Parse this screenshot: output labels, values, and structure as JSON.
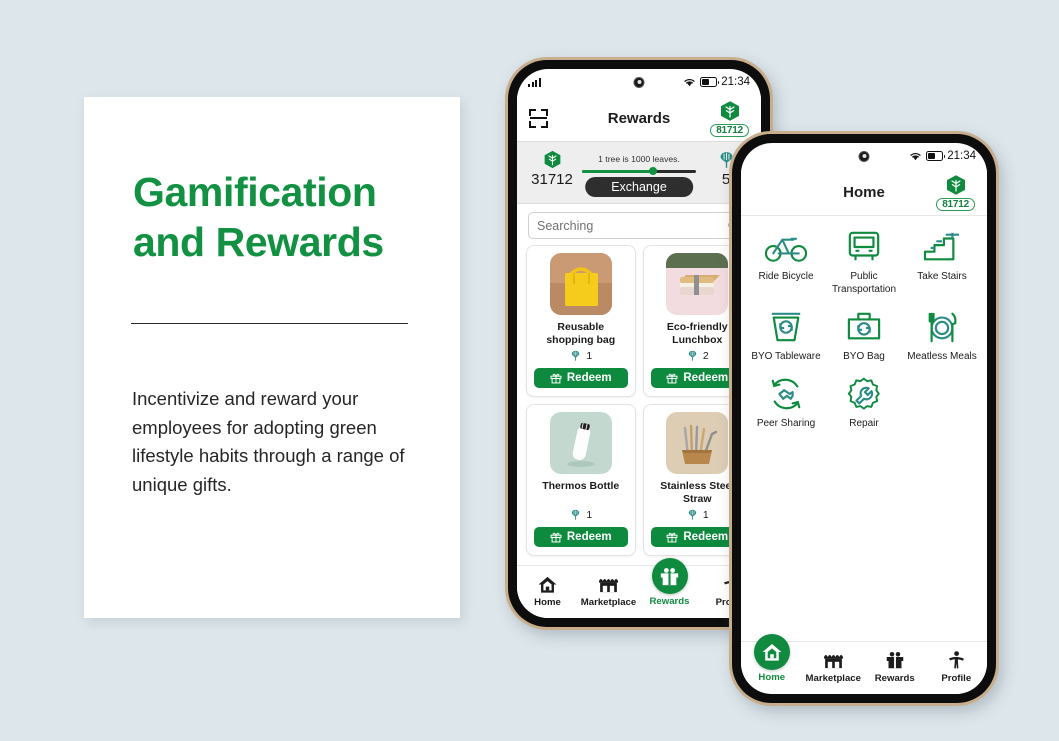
{
  "theme": {
    "background": "#dde6ea",
    "brand_green": "#119141",
    "dark_green": "#0d8a3d",
    "teal": "#2b8c86",
    "card_white": "#ffffff"
  },
  "slide": {
    "title_line1": "Gamification",
    "title_line2": "and Rewards",
    "body": "Incentivize and reward your employees for adopting green lifestyle habits through a range of unique gifts."
  },
  "rewards_phone": {
    "status": {
      "time": "21:34",
      "signal_icon": "signal-bars-icon",
      "wifi_icon": "wifi-icon",
      "battery_icon": "battery-icon",
      "camera_icon": "front-camera-icon"
    },
    "header": {
      "scan_icon": "scan-qr-icon",
      "title": "Rewards",
      "badge_icon": "leaf-hex-icon",
      "badge_value": "81712"
    },
    "exchange": {
      "leaf_icon": "leaf-hex-icon",
      "leaves_value": "31712",
      "caption": "1 tree is 1000 leaves.",
      "tree_icon": "tree-icon",
      "trees_value": "5",
      "button_label": "Exchange",
      "slider_percent": 62
    },
    "search": {
      "placeholder": "Searching",
      "value": "Searching",
      "icon": "search-icon"
    },
    "products": [
      {
        "name": "Reusable shopping bag",
        "cost": "1",
        "cost_icon": "tree-icon",
        "redeem_label": "Redeem",
        "redeem_icon": "gift-icon",
        "image": "yellow-tote-bag"
      },
      {
        "name": "Eco-friendly Lunchbox",
        "cost": "2",
        "cost_icon": "tree-icon",
        "redeem_label": "Redeem",
        "redeem_icon": "gift-icon",
        "image": "bamboo-bento-box"
      },
      {
        "name": "Thermos Bottle",
        "cost": "1",
        "cost_icon": "tree-icon",
        "redeem_label": "Redeem",
        "redeem_icon": "gift-icon",
        "image": "white-thermos-bottle"
      },
      {
        "name": "Stainless Steel Straw",
        "cost": "1",
        "cost_icon": "tree-icon",
        "redeem_label": "Redeem",
        "redeem_icon": "gift-icon",
        "image": "metal-straws-holder"
      }
    ],
    "tabs": [
      {
        "label": "Home",
        "icon": "home-icon",
        "active": false
      },
      {
        "label": "Marketplace",
        "icon": "store-icon",
        "active": false
      },
      {
        "label": "Rewards",
        "icon": "gift-icon",
        "active": true
      },
      {
        "label": "Profile",
        "icon": "person-icon",
        "active": false
      }
    ]
  },
  "home_phone": {
    "status": {
      "time": "21:34",
      "wifi_icon": "wifi-icon",
      "battery_icon": "battery-icon",
      "camera_icon": "front-camera-icon"
    },
    "header": {
      "title": "Home",
      "badge_icon": "leaf-hex-icon",
      "badge_value": "81712"
    },
    "habits": [
      {
        "label": "Ride Bicycle",
        "icon": "bicycle-icon"
      },
      {
        "label": "Public Transportation",
        "icon": "bus-icon"
      },
      {
        "label": "Take Stairs",
        "icon": "stairs-icon"
      },
      {
        "label": "BYO Tableware",
        "icon": "reusable-cup-icon"
      },
      {
        "label": "BYO Bag",
        "icon": "reusable-bag-icon"
      },
      {
        "label": "Meatless Meals",
        "icon": "plate-cutlery-icon"
      },
      {
        "label": "Peer Sharing",
        "icon": "handshake-recycle-icon"
      },
      {
        "label": "Repair",
        "icon": "gear-wrench-icon"
      }
    ],
    "tabs": [
      {
        "label": "Home",
        "icon": "home-icon",
        "active": true
      },
      {
        "label": "Marketplace",
        "icon": "store-icon",
        "active": false
      },
      {
        "label": "Rewards",
        "icon": "gift-icon",
        "active": false
      },
      {
        "label": "Profile",
        "icon": "person-icon",
        "active": false
      }
    ]
  }
}
